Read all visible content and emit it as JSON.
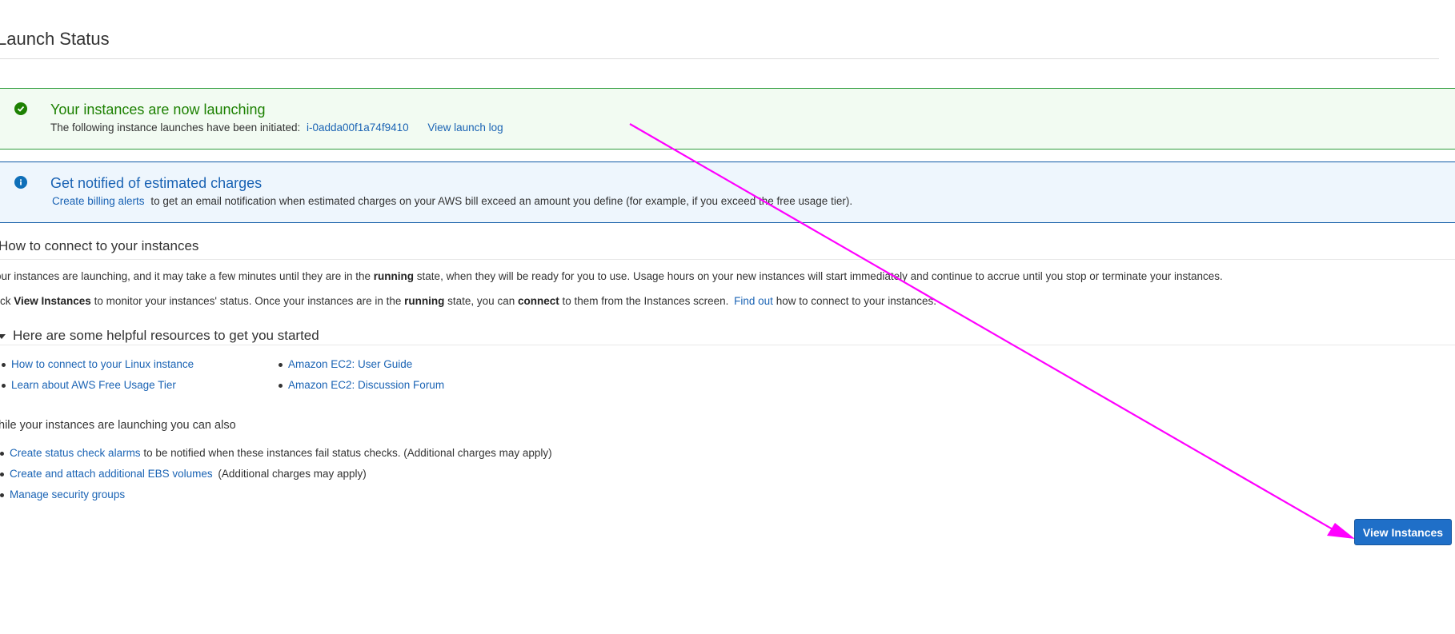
{
  "page": {
    "title": "Launch Status"
  },
  "success_alert": {
    "heading": "Your instances are now launching",
    "body_prefix": "The following instance launches have been initiated:",
    "instance_id": "i-0adda00f1a74f9410",
    "view_log_label": "View launch log",
    "icon": "check-circle-icon"
  },
  "info_alert": {
    "heading": "Get notified of estimated charges",
    "link_label": "Create billing alerts",
    "body_suffix": "to get an email notification when estimated charges on your AWS bill exceed an amount you define (for example, if you exceed the free usage tier).",
    "icon": "info-circle-icon"
  },
  "connect": {
    "heading": "How to connect to your instances",
    "para1_a": "our instances are launching, and it may take a few minutes until they are in the",
    "para1_bold": "running",
    "para1_b": "state, when they will be ready for you to use. Usage hours on your new instances will start immediately and continue to accrue until you stop or terminate your instances.",
    "para2_a": "lick",
    "para2_bold1": "View Instances",
    "para2_b": "to monitor your instances' status. Once your instances are in the",
    "para2_bold2": "running",
    "para2_c": "state, you can",
    "para2_bold3": "connect",
    "para2_d": "to them from the Instances screen.",
    "para2_link": "Find out",
    "para2_e": "how to connect to your instances."
  },
  "resources": {
    "heading": "Here are some helpful resources to get you started",
    "left": [
      "How to connect to your Linux instance",
      "Learn about AWS Free Usage Tier"
    ],
    "right": [
      "Amazon EC2: User Guide",
      "Amazon EC2: Discussion Forum"
    ]
  },
  "also": {
    "heading": "hile your instances are launching you can also",
    "item1_link": "Create status check alarms",
    "item1_text": "to be notified when these instances fail status checks. (Additional charges may apply)",
    "item2_link": "Create and attach additional EBS volumes",
    "item2_text": "(Additional charges may apply)",
    "item3_link": "Manage security groups"
  },
  "actions": {
    "view_instances_label": "View Instances"
  },
  "annotation": {
    "color": "#ff00ff"
  }
}
